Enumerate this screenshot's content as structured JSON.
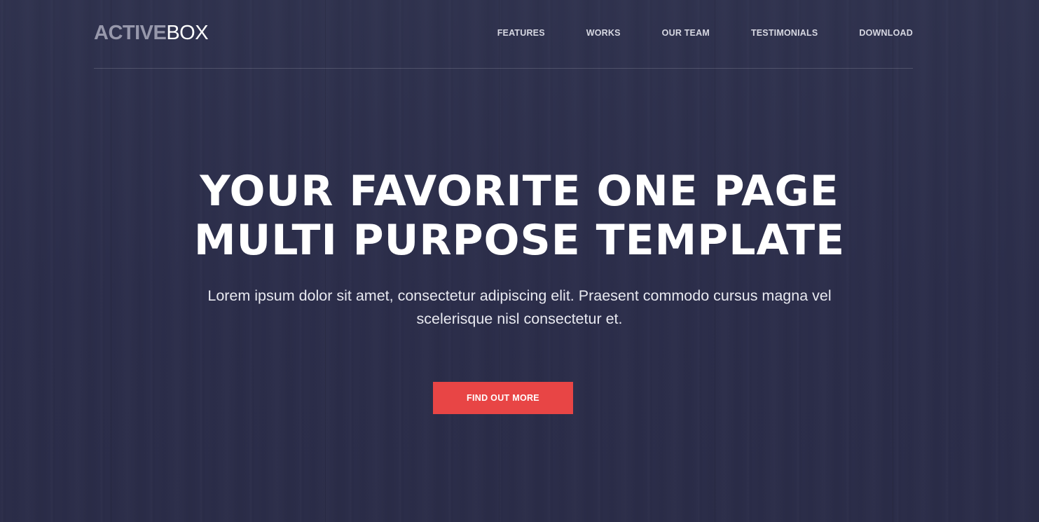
{
  "header": {
    "logo": {
      "bold": "ACTIVE",
      "light": "BOX"
    },
    "nav": [
      {
        "label": "FEATURES"
      },
      {
        "label": "WORKS"
      },
      {
        "label": "OUR TEAM"
      },
      {
        "label": "TESTIMONIALS"
      },
      {
        "label": "DOWNLOAD"
      }
    ]
  },
  "hero": {
    "title_line1": "YOUR FAVORITE ONE PAGE",
    "title_line2": "MULTI PURPOSE TEMPLATE",
    "subtitle": "Lorem ipsum dolor sit amet, consectetur adipiscing elit. Praesent commodo cursus magna vel scelerisque nisl consectetur et.",
    "cta_label": "FIND OUT MORE"
  },
  "colors": {
    "background": "#2d2f4d",
    "accent": "#e84545",
    "logo_bold": "#9798ab"
  }
}
